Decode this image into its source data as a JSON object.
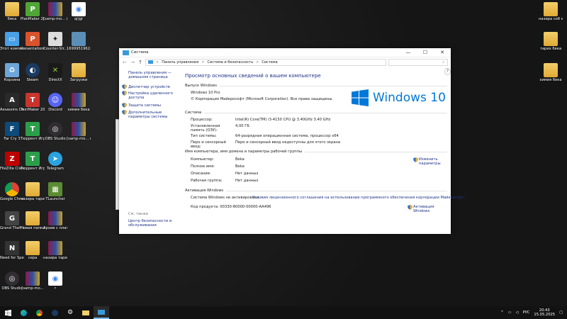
{
  "desktop_icons": [
    {
      "label": "бека",
      "icon": "folder-icon"
    },
    {
      "label": "PlanMaker 2021",
      "icon": "planmaker-icon"
    },
    {
      "label": "[samp-mo... (1)",
      "icon": "winrar-icon"
    },
    {
      "label": "qrjgr",
      "icon": "chrome-file-icon"
    },
    {
      "label": "Этот компьютер",
      "icon": "this-pc-icon"
    },
    {
      "label": "Presentations 2021",
      "icon": "presentations-icon"
    },
    {
      "label": "Counter-Str... 1.6",
      "icon": "counter-strike-icon"
    },
    {
      "label": "1699951962...",
      "icon": "image-file-icon"
    },
    {
      "label": "Корзина",
      "icon": "recycle-bin-icon"
    },
    {
      "label": "Steam",
      "icon": "steam-icon"
    },
    {
      "label": "DirectX",
      "icon": "directx-icon"
    },
    {
      "label": "Загрузки",
      "icon": "downloads-folder-icon"
    },
    {
      "label": "Assassins Creed 2",
      "icon": "assassins-creed-icon"
    },
    {
      "label": "TextMaker 2021",
      "icon": "textmaker-icon"
    },
    {
      "label": "Discord",
      "icon": "discord-icon"
    },
    {
      "label": "химия бека",
      "icon": "winrar-icon"
    },
    {
      "label": "Far Cry 3",
      "icon": "far-cry-icon"
    },
    {
      "label": "Тюррент Игруха",
      "icon": "torrent-icon"
    },
    {
      "label": "OBS Studio",
      "icon": "obs-icon"
    },
    {
      "label": "[samp-mo... матем",
      "icon": "winrar-icon"
    },
    {
      "label": "FileZilla Client",
      "icon": "filezilla-icon"
    },
    {
      "label": "Тюррент Игруха",
      "icon": "torrent-icon"
    },
    {
      "label": "Telegram",
      "icon": "telegram-icon"
    },
    {
      "label": "Google Chrome",
      "icon": "chrome-icon"
    },
    {
      "label": "назира тарих",
      "icon": "folder-icon"
    },
    {
      "label": "TLauncher",
      "icon": "tlauncher-icon"
    },
    {
      "label": "Grand Theft Auto San ...",
      "icon": "gta-icon"
    },
    {
      "label": "Новая папка",
      "icon": "folder-icon"
    },
    {
      "label": "Архив с платежне...",
      "icon": "winrar-icon"
    },
    {
      "label": "Need for Speed Mo...",
      "icon": "nfs-icon"
    },
    {
      "label": "сера",
      "icon": "folder-icon"
    },
    {
      "label": "назира тарих",
      "icon": "winrar-icon"
    },
    {
      "label": "OBS Studio",
      "icon": "obs-icon"
    },
    {
      "label": "[samp-mo...",
      "icon": "winrar-icon"
    },
    {
      "label": "г",
      "icon": "chrome-file-icon"
    },
    {
      "label": "назира соб матеш",
      "icon": "folder-icon"
    },
    {
      "label": "тарих бека",
      "icon": "folder-icon"
    },
    {
      "label": "химия бека",
      "icon": "folder-icon"
    }
  ],
  "window": {
    "title": "Система",
    "minimize": "—",
    "maximize": "☐",
    "close": "✕",
    "nav_back": "←",
    "nav_forward": "→",
    "nav_up": "↑",
    "breadcrumb": [
      "Панель управления",
      "Система и безопасность",
      "Система"
    ],
    "breadcrumb_sep": ">",
    "search_placeholder": "",
    "search_icon": "search-icon",
    "left_home": "Панель управления — домашняя страница",
    "left_links": [
      "Диспетчер устройств",
      "Настройка удаленного доступа",
      "Защита системы",
      "Дополнительные параметры системы"
    ],
    "see_also": "См. также",
    "security_link": "Центр безопасности и обслуживания",
    "page_title": "Просмотр основных сведений о вашем компьютере",
    "edition_header": "Выпуск Windows",
    "edition": "Windows 10 Pro",
    "copyright": "© Корпорация Майкрософт (Microsoft Corporation). Все права защищены.",
    "logo_text": "Windows 10",
    "system_header": "Система",
    "system_rows": [
      {
        "key": "Процессор:",
        "value": "Intel(R) Core(TM) i3-4150 CPU @ 3.40GHz   3.40 GHz"
      },
      {
        "key": "Установленная память (ОЗУ):",
        "value": "4,00 ГБ"
      },
      {
        "key": "Тип системы:",
        "value": "64-разрядная операционная система, процессор x64"
      },
      {
        "key": "Перо и сенсорный ввод:",
        "value": "Перо и сенсорный ввод недоступны для этого экрана"
      }
    ],
    "name_header": "Имя компьютера, имя домена и параметры рабочей группы",
    "name_rows": [
      {
        "key": "Компьютер:",
        "value": "Beka"
      },
      {
        "key": "Полное имя:",
        "value": "Beka"
      },
      {
        "key": "Описание:",
        "value": "Нет данных"
      },
      {
        "key": "Рабочая группа:",
        "value": "Нет данных"
      }
    ],
    "change_params": "Изменить параметры",
    "activation_header": "Активация Windows",
    "activation_status": "Система Windows не активирована.",
    "license_link": "Условия лицензионного соглашения на использование программного обеспечения корпорации Майкрософт",
    "product_code": "Код продукта: 00330-80000-00000-AA496",
    "activate_link": "Активация Windows"
  },
  "taskbar": {
    "start_icon": "windows-start-icon",
    "items": [
      "edge-icon",
      "chrome-icon",
      "steam-icon",
      "settings-icon",
      "explorer-icon",
      "system-window-icon"
    ],
    "language": "РУС",
    "time": "20:43",
    "date": "15.05.2025"
  },
  "colors": {
    "accent": "#0078d7",
    "link": "#1e3287"
  }
}
